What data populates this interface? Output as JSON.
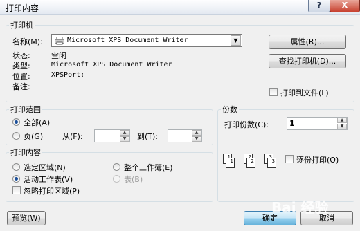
{
  "window": {
    "title": "打印内容",
    "help": "?",
    "close": "X"
  },
  "printer": {
    "group_label": "打印机",
    "name_label": "名称(M):",
    "name_value": "Microsoft XPS Document Writer",
    "status_label": "状态:",
    "status_value": "空闲",
    "type_label": "类型:",
    "type_value": "Microsoft XPS Document Writer",
    "where_label": "位置:",
    "where_value": "XPSPort:",
    "comment_label": "备注:",
    "comment_value": "",
    "properties_button": "属性(R)...",
    "find_button": "查找打印机(D)...",
    "print_to_file_label": "打印到文件(L)",
    "print_to_file_checked": false
  },
  "range": {
    "group_label": "打印范围",
    "all_label": "全部(A)",
    "pages_label": "页(G)",
    "from_label": "从(F):",
    "to_label": "到(T):",
    "from_value": "",
    "to_value": "",
    "selected": "all"
  },
  "copies": {
    "group_label": "份数",
    "count_label": "打印份数(C):",
    "count_value": "1",
    "collate_label": "逐份打印(O)",
    "collate_checked": false,
    "page_icons": [
      "1",
      "1",
      "2",
      "2",
      "3",
      "3"
    ]
  },
  "content": {
    "group_label": "打印内容",
    "selection_label": "选定区域(N)",
    "workbook_label": "整个工作簿(E)",
    "active_sheet_label": "活动工作表(V)",
    "table_label": "表(B)",
    "ignore_area_label": "忽略打印区域(P)",
    "ignore_area_checked": false,
    "selected": "active_sheet"
  },
  "footer": {
    "preview_button": "预览(W)",
    "ok_button": "确定",
    "cancel_button": "取消"
  },
  "watermark": "Bai 经验"
}
